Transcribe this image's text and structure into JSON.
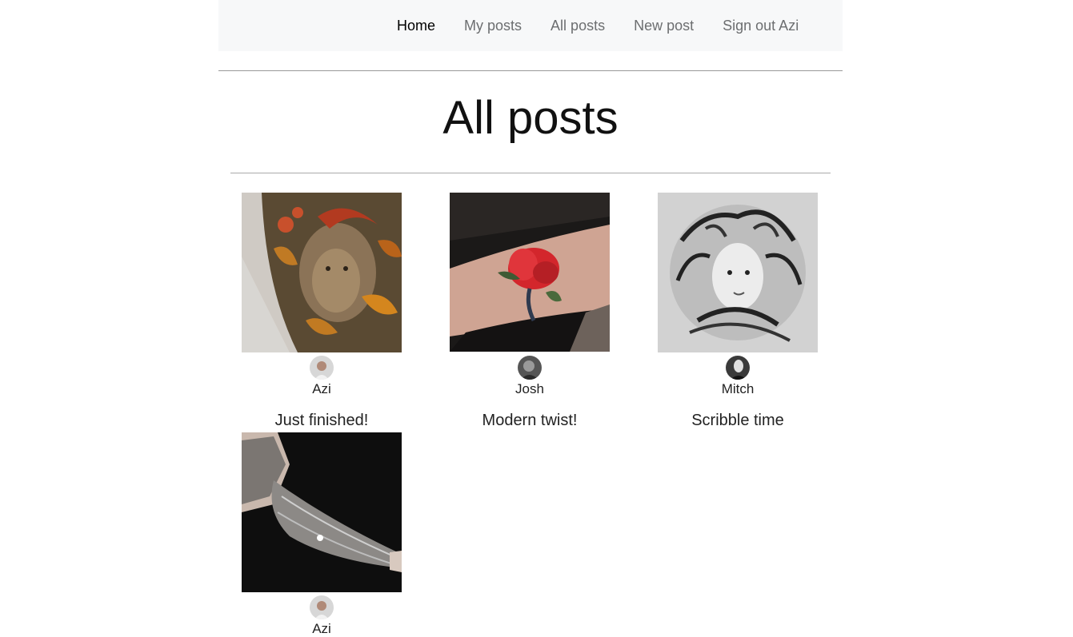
{
  "nav": {
    "links": [
      {
        "label": "Home",
        "active": true
      },
      {
        "label": "My posts",
        "active": false
      },
      {
        "label": "All posts",
        "active": false
      },
      {
        "label": "New post",
        "active": false
      },
      {
        "label": "Sign out Azi",
        "active": false
      }
    ]
  },
  "page": {
    "title": "All posts"
  },
  "posts": [
    {
      "author": "Azi",
      "caption": "Just finished!",
      "image": "tattoo-portrait-autumn-leaves"
    },
    {
      "author": "Josh",
      "caption": "Modern twist!",
      "image": "tattoo-red-poppy-forearm"
    },
    {
      "author": "Mitch",
      "caption": "Scribble time",
      "image": "tattoo-medusa-sketch"
    },
    {
      "author": "Azi",
      "caption": "",
      "image": "tattoo-mandala-sleeve"
    }
  ],
  "colors": {
    "navbar_bg": "#f7f8f9",
    "nav_text": "#6c6e70",
    "nav_active": "#000000"
  }
}
